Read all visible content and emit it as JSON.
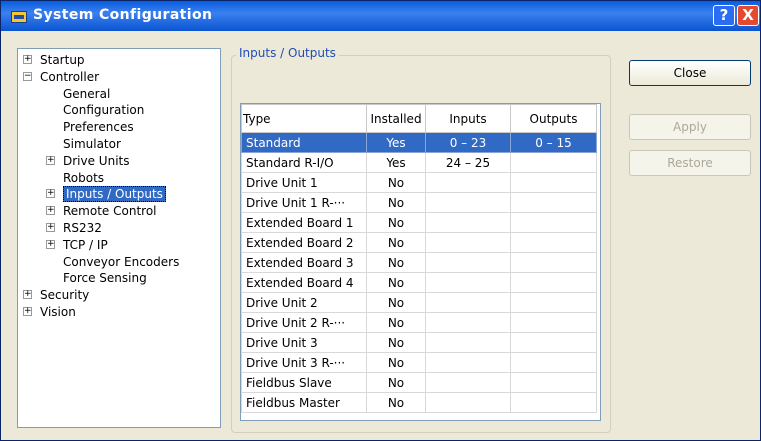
{
  "window": {
    "title": "System Configuration",
    "help_label": "?",
    "close_label": "X"
  },
  "tree": {
    "items": [
      {
        "label": "Startup",
        "level": 0,
        "expander": "+"
      },
      {
        "label": "Controller",
        "level": 0,
        "expander": "−"
      },
      {
        "label": "General",
        "level": 1,
        "expander": ""
      },
      {
        "label": "Configuration",
        "level": 1,
        "expander": ""
      },
      {
        "label": "Preferences",
        "level": 1,
        "expander": ""
      },
      {
        "label": "Simulator",
        "level": 1,
        "expander": ""
      },
      {
        "label": "Drive Units",
        "level": 1,
        "expander": "+"
      },
      {
        "label": "Robots",
        "level": 1,
        "expander": ""
      },
      {
        "label": "Inputs / Outputs",
        "level": 1,
        "expander": "+",
        "selected": true
      },
      {
        "label": "Remote Control",
        "level": 1,
        "expander": "+"
      },
      {
        "label": "RS232",
        "level": 1,
        "expander": "+"
      },
      {
        "label": "TCP / IP",
        "level": 1,
        "expander": "+"
      },
      {
        "label": "Conveyor Encoders",
        "level": 1,
        "expander": ""
      },
      {
        "label": "Force Sensing",
        "level": 1,
        "expander": ""
      },
      {
        "label": "Security",
        "level": 0,
        "expander": "+"
      },
      {
        "label": "Vision",
        "level": 0,
        "expander": "+"
      }
    ]
  },
  "io": {
    "group_label": "Inputs / Outputs",
    "columns": [
      "Type",
      "Installed",
      "Inputs",
      "Outputs"
    ],
    "rows": [
      [
        "Standard",
        "Yes",
        "0 – 23",
        "0 – 15"
      ],
      [
        "Standard R-I/O",
        "Yes",
        "24 – 25",
        ""
      ],
      [
        "Drive Unit 1",
        "No",
        "",
        ""
      ],
      [
        "Drive Unit 1 R-···",
        "No",
        "",
        ""
      ],
      [
        "Extended Board 1",
        "No",
        "",
        ""
      ],
      [
        "Extended Board 2",
        "No",
        "",
        ""
      ],
      [
        "Extended Board 3",
        "No",
        "",
        ""
      ],
      [
        "Extended Board 4",
        "No",
        "",
        ""
      ],
      [
        "Drive Unit 2",
        "No",
        "",
        ""
      ],
      [
        "Drive Unit 2 R-···",
        "No",
        "",
        ""
      ],
      [
        "Drive Unit 3",
        "No",
        "",
        ""
      ],
      [
        "Drive Unit 3 R-···",
        "No",
        "",
        ""
      ],
      [
        "Fieldbus Slave",
        "No",
        "",
        ""
      ],
      [
        "Fieldbus Master",
        "No",
        "",
        ""
      ]
    ],
    "selected_row": 0
  },
  "buttons": {
    "close": "Close",
    "apply": "Apply",
    "restore": "Restore"
  }
}
